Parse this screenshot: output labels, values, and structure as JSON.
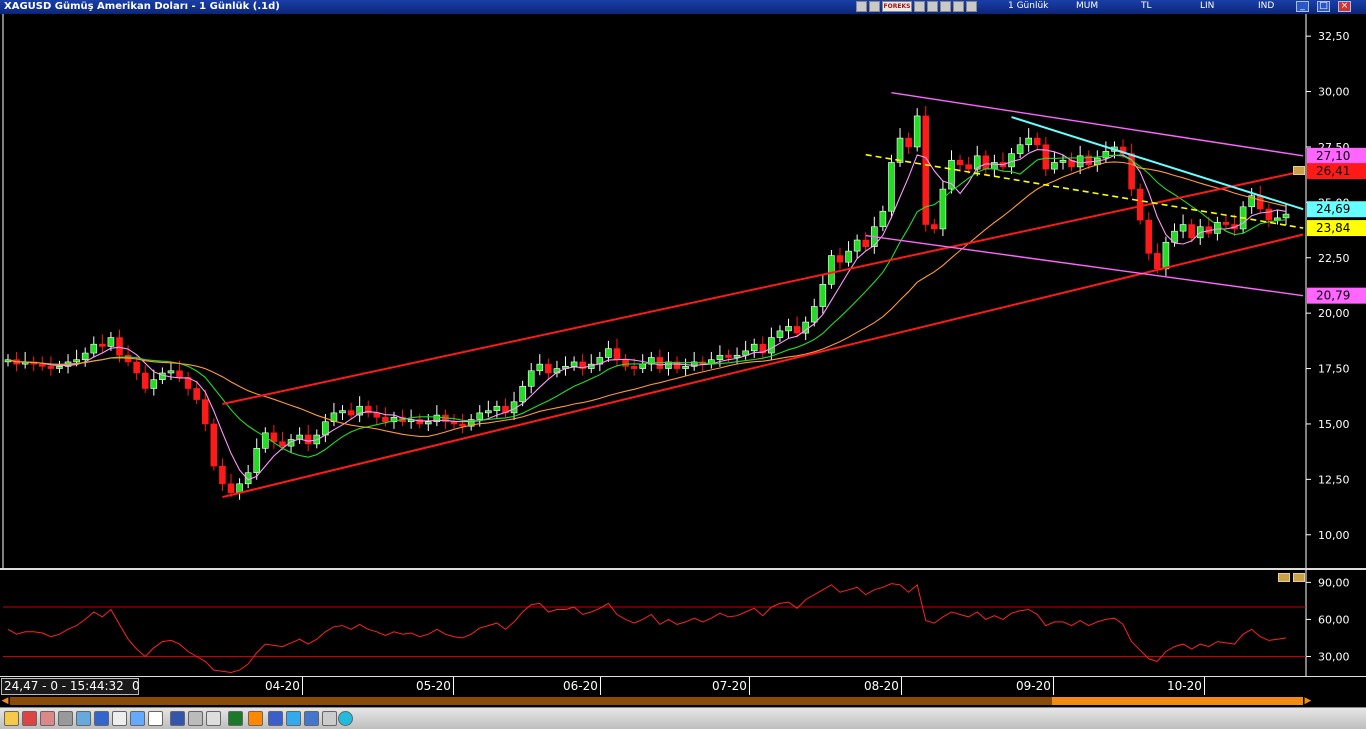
{
  "window": {
    "title": "XAGUSD Gümüş Amerikan Doları - 1 Günlük (.1d)",
    "forex_badge": "FOREKS",
    "menu": [
      "1 Günlük",
      "MUM",
      "TL",
      "LIN",
      "IND"
    ]
  },
  "colors": {
    "background": "#000000",
    "bull_candle": "#22dd22",
    "bear_candle": "#ff1a1a",
    "channel": "#ff1a1a",
    "pink_channel": "#ff66ff",
    "cyan_trend": "#66ffff",
    "yellow_dashed": "#ffff00",
    "ma_fast": "#ff99ff",
    "ma_mid": "#22dd22",
    "ma_slow": "#ff9933",
    "rsi_line": "#ff2222"
  },
  "chart_data": [
    {
      "type": "candlestick",
      "title": "XAGUSD Gümüş Amerikan Doları - 1 Günlük (.1d)",
      "ylim": [
        8.5,
        33.5
      ],
      "y_ticks": [
        "10,00",
        "12,50",
        "15,00",
        "17,50",
        "20,00",
        "22,50",
        "25,00",
        "27,50",
        "30,00",
        "32,50"
      ],
      "x_ticks": [
        "04-20",
        "05-20",
        "06-20",
        "07-20",
        "08-20",
        "09-20",
        "10-20"
      ],
      "x_cut_label": "0",
      "closes": [
        17.9,
        17.7,
        17.8,
        17.7,
        17.6,
        17.5,
        17.6,
        17.8,
        17.9,
        18.2,
        18.6,
        18.5,
        18.9,
        18.1,
        17.8,
        17.3,
        16.6,
        17.0,
        17.3,
        17.4,
        17.1,
        16.6,
        16.1,
        15.0,
        13.1,
        12.3,
        11.9,
        12.3,
        12.8,
        13.9,
        14.6,
        14.2,
        14.0,
        14.3,
        14.5,
        14.1,
        14.5,
        15.1,
        15.5,
        15.6,
        15.4,
        15.8,
        15.5,
        15.3,
        15.1,
        15.3,
        15.1,
        15.2,
        15.0,
        15.1,
        15.4,
        15.1,
        15.0,
        14.9,
        15.2,
        15.5,
        15.6,
        15.8,
        15.5,
        16.0,
        16.7,
        17.4,
        17.7,
        17.3,
        17.5,
        17.6,
        17.8,
        17.5,
        17.7,
        18.0,
        18.4,
        17.9,
        17.6,
        17.5,
        17.7,
        18.0,
        17.5,
        17.8,
        17.5,
        17.6,
        17.8,
        17.7,
        17.9,
        18.1,
        18.0,
        18.1,
        18.3,
        18.6,
        18.2,
        18.9,
        19.2,
        19.4,
        19.1,
        19.6,
        20.3,
        21.3,
        22.6,
        22.3,
        22.8,
        23.3,
        23.0,
        23.9,
        24.6,
        26.8,
        27.9,
        27.5,
        28.9,
        24.0,
        23.8,
        25.6,
        26.9,
        26.7,
        26.5,
        27.1,
        26.5,
        26.8,
        26.6,
        27.2,
        27.6,
        27.9,
        27.6,
        26.5,
        26.8,
        26.9,
        26.6,
        27.1,
        26.7,
        27.0,
        27.3,
        27.5,
        27.2,
        25.6,
        24.2,
        22.7,
        22.0,
        23.2,
        23.7,
        24.0,
        23.4,
        23.9,
        23.6,
        24.1,
        24.0,
        23.8,
        24.8,
        25.3,
        24.7,
        24.2,
        24.3,
        24.47
      ],
      "moving_averages": [
        "fast (pink)",
        "mid (green)",
        "slow (orange)"
      ],
      "trendlines": [
        "red ascending channel",
        "pink descending channel",
        "cyan trend line",
        "yellow dashed line"
      ],
      "price_labels": [
        {
          "value": "27,10",
          "color": "#ff66ff"
        },
        {
          "value": "26,41",
          "color": "#ff1a1a"
        },
        {
          "value": "24,69",
          "color": "#66ffff"
        },
        {
          "value": "23,84",
          "color": "#ffff00"
        },
        {
          "value": "20,79",
          "color": "#ff66ff"
        }
      ]
    },
    {
      "type": "line",
      "ylim": [
        15,
        100
      ],
      "y_ticks": [
        "30,00",
        "60,00",
        "90,00"
      ],
      "hlines": [
        30,
        70
      ],
      "values": [
        52,
        48,
        50,
        50,
        49,
        46,
        48,
        52,
        55,
        60,
        66,
        62,
        68,
        56,
        44,
        36,
        30,
        37,
        42,
        43,
        40,
        34,
        30,
        26,
        19,
        18,
        17,
        19,
        24,
        33,
        40,
        39,
        38,
        41,
        44,
        40,
        44,
        50,
        54,
        55,
        52,
        56,
        52,
        50,
        47,
        50,
        48,
        49,
        46,
        48,
        52,
        48,
        46,
        45,
        48,
        53,
        55,
        57,
        52,
        58,
        66,
        72,
        73,
        66,
        68,
        68,
        70,
        64,
        66,
        69,
        73,
        64,
        60,
        57,
        60,
        64,
        56,
        60,
        56,
        58,
        61,
        58,
        61,
        65,
        62,
        63,
        66,
        69,
        63,
        70,
        73,
        74,
        69,
        76,
        80,
        84,
        88,
        82,
        84,
        86,
        80,
        84,
        86,
        89,
        88,
        82,
        88,
        59,
        57,
        62,
        66,
        64,
        62,
        66,
        60,
        63,
        60,
        65,
        67,
        68,
        64,
        55,
        58,
        58,
        55,
        59,
        55,
        58,
        60,
        61,
        56,
        42,
        35,
        28,
        26,
        34,
        38,
        40,
        36,
        40,
        38,
        42,
        41,
        40,
        48,
        52,
        46,
        43,
        44,
        45
      ]
    }
  ],
  "status": {
    "readout": "24,47 - 0 - 15:44:32"
  }
}
